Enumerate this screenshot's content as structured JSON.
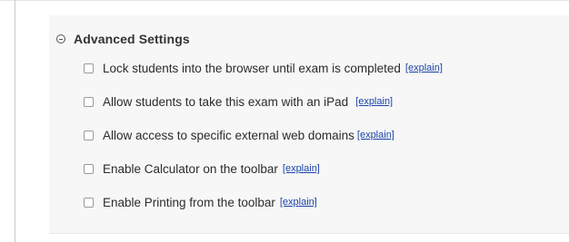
{
  "section": {
    "title": "Advanced Settings",
    "toggle_icon": "collapse-minus-icon"
  },
  "options": [
    {
      "label": "Lock students into the browser until exam is completed",
      "link": "[explain]",
      "checked": false
    },
    {
      "label": "Allow students to take this exam with an iPad",
      "link": "[explain]",
      "checked": false
    },
    {
      "label": "Allow access to specific external web domains",
      "link": "[explain]",
      "checked": false
    },
    {
      "label": "Enable Calculator on the toolbar",
      "link": "[explain]",
      "checked": false
    },
    {
      "label": "Enable Printing from the toolbar",
      "link": "[explain]",
      "checked": false
    }
  ],
  "colors": {
    "panel_background": "#f7f7f7",
    "link": "#1a44a8",
    "text": "#2b2b2b"
  }
}
